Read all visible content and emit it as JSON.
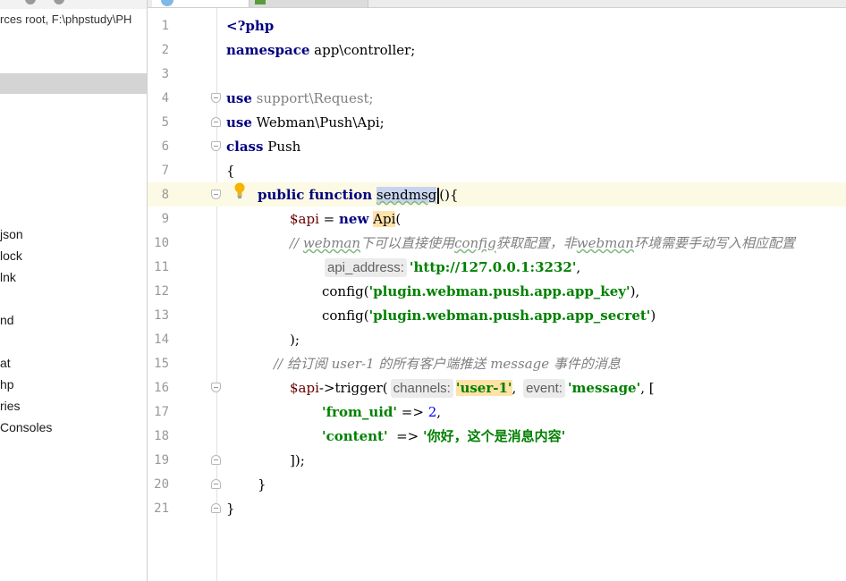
{
  "sidebar": {
    "root_label": "rces root,  F:\\phpstudy\\PH",
    "items": [
      "json",
      "lock",
      "lnk",
      "nd",
      "at",
      "hp",
      "ries",
      " Consoles"
    ]
  },
  "editor": {
    "line_numbers": [
      "1",
      "2",
      "3",
      "4",
      "5",
      "6",
      "7",
      "8",
      "9",
      "10",
      "11",
      "12",
      "13",
      "14",
      "15",
      "16",
      "17",
      "18",
      "19",
      "20",
      "21"
    ],
    "l1": "<?php",
    "l2_kw": "namespace",
    "l2_rest": " app\\controller;",
    "l4_kw": "use",
    "l4_rest": " support\\Request;",
    "l5_kw": "use",
    "l5_rest": " Webman\\Push\\Api;",
    "l6_kw": "class",
    "l6_rest": " Push",
    "l7": "{",
    "l8_kw1": "public",
    "l8_kw2": "function",
    "l8_name": "sendmsg",
    "l8_rest": "(){",
    "l9_var": "$api",
    "l9_eq": " = ",
    "l9_new": "new",
    "l9_cls": "Api",
    "l9_paren": "(",
    "l10_comment_pre": "// ",
    "l10_w1": "webman",
    "l10_t1": "下可以直接使用",
    "l10_w2": "config",
    "l10_t2": "获取配置，非",
    "l10_w3": "webman",
    "l10_t3": "环境需要手动写入相应配置",
    "l11_hint": "api_address:",
    "l11_str": "'http://127.0.0.1:3232'",
    "l11_end": ",",
    "l12_fn": "config(",
    "l12_str": "'plugin.webman.push.app.app_key'",
    "l12_end": "),",
    "l13_fn": "config(",
    "l13_str": "'plugin.webman.push.app.app_secret'",
    "l13_end": ")",
    "l14": ");",
    "l15_comment": "// 给订阅 user-1 的所有客户端推送 message 事件的消息",
    "l16_var": "$api",
    "l16_call": "->trigger(",
    "l16_hint1": "channels:",
    "l16_str1": "'user-1'",
    "l16_sep": ",",
    "l16_hint2": "event:",
    "l16_str2": "'message'",
    "l16_end": ", [",
    "l17_key": "'from_uid'",
    "l17_arrow": " => ",
    "l17_num": "2",
    "l17_end": ",",
    "l18_key": "'content'",
    "l18_arrow": "  => ",
    "l18_str": "'你好，这个是消息内容'",
    "l19": "]);",
    "l20": "}",
    "l21": "}"
  }
}
